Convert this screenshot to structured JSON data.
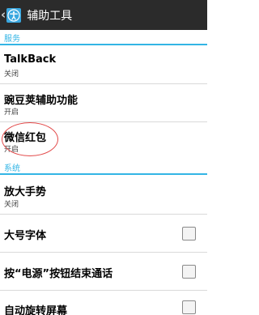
{
  "actionbar": {
    "title": "辅助工具",
    "back_icon": "chevron-left-icon",
    "app_icon": "accessibility-icon"
  },
  "sections": {
    "services": {
      "label": "服务"
    },
    "system": {
      "label": "系统"
    }
  },
  "services_items": [
    {
      "title": "TalkBack",
      "status": "关闭"
    },
    {
      "title": "豌豆荚辅助功能",
      "status": "开启"
    },
    {
      "title": "微信红包",
      "status": "开启"
    }
  ],
  "system_items": [
    {
      "title": "放大手势",
      "status": "关闭"
    },
    {
      "title": "大号字体",
      "checked": false
    },
    {
      "title": "按“电源”按钮结束通话",
      "checked": false
    },
    {
      "title": "自动旋转屏幕",
      "checked": false
    }
  ],
  "colors": {
    "actionbar_bg": "#2b2b2b",
    "accent": "#33b5e5",
    "highlight": "#e24848"
  }
}
